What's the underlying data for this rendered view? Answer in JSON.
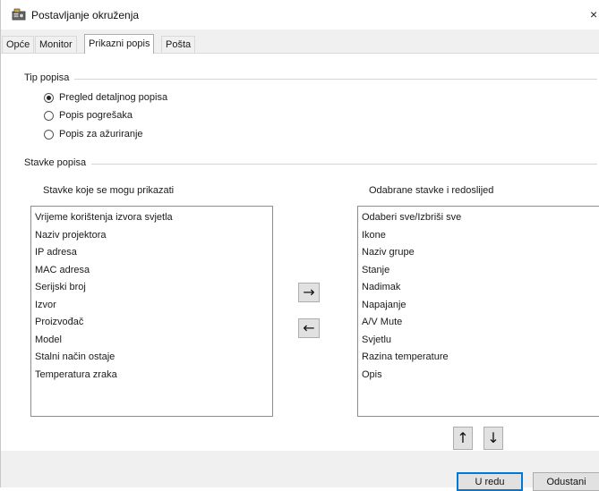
{
  "window": {
    "title": "Postavljanje okruženja",
    "close_glyph": "×",
    "icon": "app-icon"
  },
  "tabs": [
    {
      "label": "Opće",
      "active": false
    },
    {
      "label": "Monitor",
      "active": false
    },
    {
      "label": "Prikazni popis",
      "active": true
    },
    {
      "label": "Pošta",
      "active": false
    }
  ],
  "list_type": {
    "group_label": "Tip popisa",
    "options": [
      {
        "label": "Pregled detaljnog popisa",
        "checked": true
      },
      {
        "label": "Popis pogrešaka",
        "checked": false
      },
      {
        "label": "Popis za ažuriranje",
        "checked": false
      }
    ]
  },
  "list_items": {
    "group_label": "Stavke popisa",
    "available_label": "Stavke koje se mogu prikazati",
    "selected_label": "Odabrane stavke i redoslijed",
    "available": [
      "Vrijeme korištenja izvora svjetla",
      "Naziv projektora",
      "IP adresa",
      "MAC adresa",
      "Serijski broj",
      "Izvor",
      "Proizvođač",
      "Model",
      "Stalni način ostaje",
      "Temperatura zraka"
    ],
    "selected": [
      "Odaberi sve/Izbriši sve",
      "Ikone",
      "Naziv grupe",
      "Stanje",
      "Nadimak",
      "Napajanje",
      "A/V Mute",
      "Svjetlu",
      "Razina temperature",
      "Opis"
    ],
    "move_right_glyph": "→",
    "move_left_glyph": "←",
    "move_up_glyph": "↑",
    "move_down_glyph": "↓"
  },
  "footer": {
    "ok_label": "U redu",
    "cancel_label": "Odustani"
  },
  "colors": {
    "accent": "#0078d7",
    "panel": "#ffffff",
    "chrome": "#f0f0f0"
  }
}
